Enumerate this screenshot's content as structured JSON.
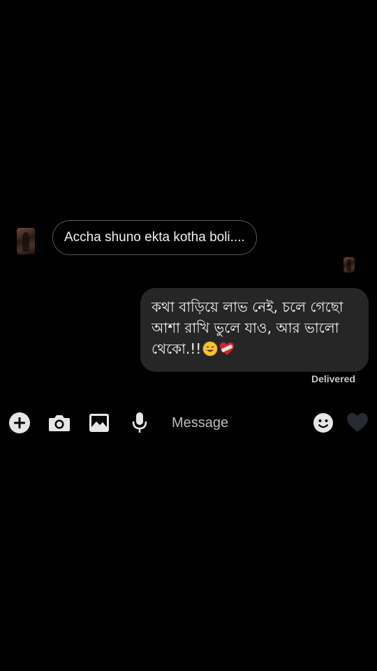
{
  "conversation": {
    "incoming": {
      "text": "Accha shuno ekta kotha boli...."
    },
    "outgoing": {
      "lines": [
        "কথা বাড়িয়ে লাভ নেই, চলে গেছো",
        "আশা রাখি ভুলে যাও, আর ভালো",
        "থেকো.!!"
      ],
      "emoji": [
        "smiling-face-icon",
        "heart-with-bandage-icon"
      ]
    },
    "status": "Delivered"
  },
  "composer": {
    "placeholder": "Message",
    "icons": [
      "plus-icon",
      "camera-icon",
      "gallery-icon",
      "microphone-icon",
      "emoji-icon",
      "heart-icon"
    ]
  },
  "colors": {
    "background": "#000000",
    "outgoing_bubble": "#262626",
    "incoming_border": "#5a5a5a",
    "icon": "#e6e6e6"
  }
}
